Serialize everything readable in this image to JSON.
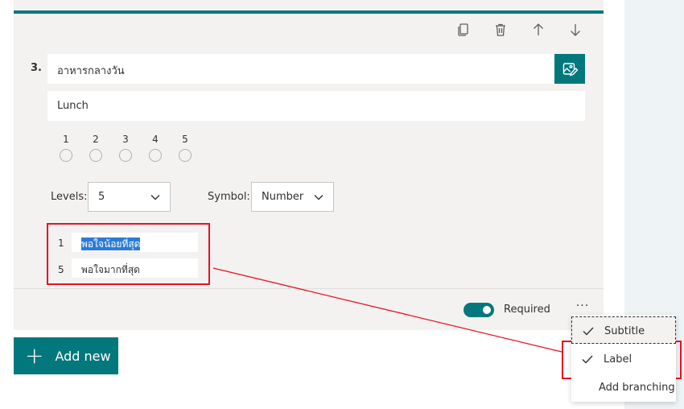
{
  "question": {
    "number": "3.",
    "title": "อาหารกลางวัน",
    "subtitle": "Lunch"
  },
  "rating": {
    "scale": [
      "1",
      "2",
      "3",
      "4",
      "5"
    ]
  },
  "settings": {
    "levels_label": "Levels:",
    "levels_value": "5",
    "symbol_label": "Symbol:",
    "symbol_value": "Number"
  },
  "labels": [
    {
      "num": "1",
      "text": "พอใจน้อยที่สุด",
      "selected": true
    },
    {
      "num": "5",
      "text": "พอใจมากที่สุด",
      "selected": false
    }
  ],
  "footer": {
    "required_label": "Required",
    "required_on": true,
    "more_label": "···"
  },
  "add_new": {
    "label": "Add new"
  },
  "menu": {
    "items": [
      {
        "label": "Subtitle",
        "checked": true
      },
      {
        "label": "Label",
        "checked": true
      },
      {
        "label": "Add branching",
        "checked": false
      }
    ]
  },
  "colors": {
    "accent": "#03787c",
    "highlight": "#e81123",
    "selection": "#2b7bd8"
  },
  "icons": [
    "copy-icon",
    "delete-icon",
    "arrow-up-icon",
    "arrow-down-icon",
    "image-edit-icon",
    "chevron-down-icon",
    "check-icon",
    "plus-icon"
  ]
}
